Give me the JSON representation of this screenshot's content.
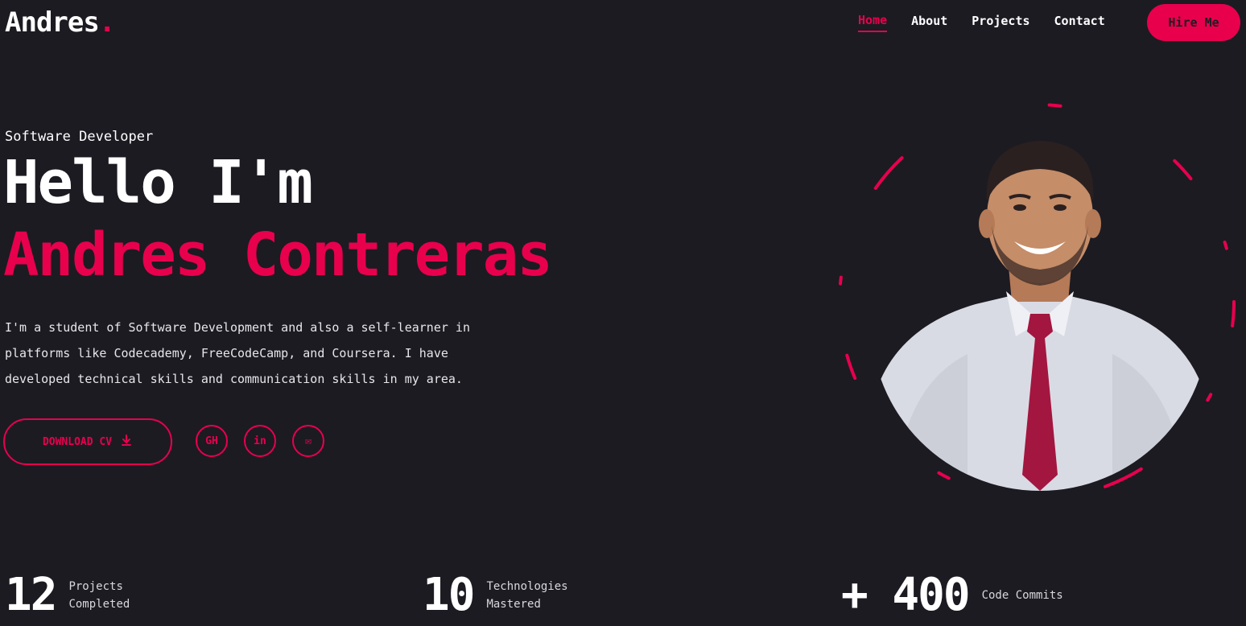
{
  "header": {
    "logo": "Andres",
    "logo_dot": ".",
    "nav": [
      "Home",
      "About",
      "Projects",
      "Contact"
    ],
    "hire_label": "Hire Me"
  },
  "hero": {
    "role": "Software Developer",
    "greeting": "Hello I'm",
    "name": "Andres Contreras",
    "bio": "I'm a student of Software Development and also a self-learner in platforms like Codecademy, FreeCodeCamp, and Coursera. I have developed technical skills and communication skills in my area.",
    "cv_label": "DOWNLOAD CV",
    "cv_icon": "download-icon",
    "socials": [
      {
        "name": "github-icon",
        "glyph": "GH"
      },
      {
        "name": "linkedin-icon",
        "glyph": "in"
      },
      {
        "name": "email-icon",
        "glyph": "✉"
      }
    ]
  },
  "stats": [
    {
      "number": "12",
      "label": "Projects Completed"
    },
    {
      "number": "10",
      "label": "Technologies Mastered"
    },
    {
      "number": "+ 400",
      "label": "Code Commits"
    }
  ],
  "colors": {
    "background": "#1c1b22",
    "accent": "#e8004d",
    "text": "#ffffff"
  }
}
